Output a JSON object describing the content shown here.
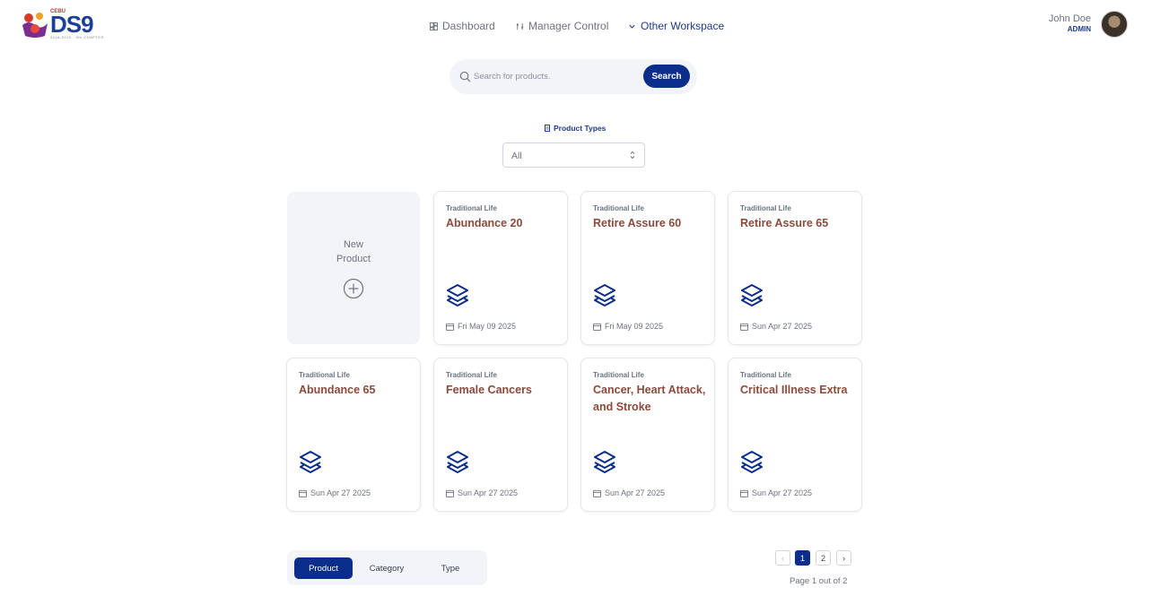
{
  "brand": {
    "logo_text": "DS9",
    "logo_top": "CEBU",
    "logo_sub": "2018-2019 · 9th CHAPTER"
  },
  "nav": {
    "dashboard": "Dashboard",
    "manager": "Manager Control",
    "other": "Other Workspace"
  },
  "user": {
    "name": "John Doe",
    "role": "ADMIN"
  },
  "search": {
    "placeholder": "Search for products.",
    "button": "Search"
  },
  "filter": {
    "label": "Product Types",
    "selected": "All"
  },
  "new_product": {
    "line1": "New",
    "line2": "Product"
  },
  "products": [
    {
      "type": "Traditional Life",
      "title": "Abundance 20",
      "date": "Fri May 09 2025"
    },
    {
      "type": "Traditional Life",
      "title": "Retire Assure 60",
      "date": "Fri May 09 2025"
    },
    {
      "type": "Traditional Life",
      "title": "Retire Assure 65",
      "date": "Sun Apr 27 2025"
    },
    {
      "type": "Traditional Life",
      "title": "Abundance 65",
      "date": "Sun Apr 27 2025"
    },
    {
      "type": "Traditional Life",
      "title": "Female Cancers",
      "date": "Sun Apr 27 2025"
    },
    {
      "type": "Traditional Life",
      "title": "Cancer, Heart Attack, and Stroke",
      "date": "Sun Apr 27 2025"
    },
    {
      "type": "Traditional Life",
      "title": "Critical Illness Extra",
      "date": "Sun Apr 27 2025"
    }
  ],
  "tabs": [
    "Product",
    "Category",
    "Type"
  ],
  "pagination": {
    "prev": "‹",
    "pages": [
      "1",
      "2"
    ],
    "next": "›",
    "info": "Page 1 out of 2"
  },
  "colors": {
    "primary": "#0b2e8a",
    "accent": "#e8730f"
  }
}
